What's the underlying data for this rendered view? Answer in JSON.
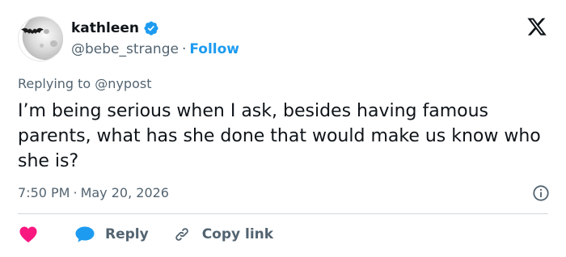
{
  "tweet": {
    "display_name": "kathleen",
    "handle": "@bebe_strange",
    "separator": "·",
    "follow_label": "Follow",
    "replying_prefix": "Replying to",
    "replying_to": "@nypost",
    "text": "I’m being serious when I ask, besides having famous parents, what has she done that would make us know who she is?",
    "time": "7:50 PM",
    "date": "May 20, 2026"
  },
  "actions": {
    "reply_label": "Reply",
    "copy_link_label": "Copy link"
  },
  "colors": {
    "accent": "#1d9bf0",
    "heart": "#f91880",
    "muted_text": "#536471",
    "primary_text": "#0f1419"
  },
  "icons": {
    "avatar": "moon-bat-avatar",
    "verified": "verified-badge-icon",
    "logo": "x-logo-icon",
    "info": "info-icon",
    "like": "heart-icon",
    "reply": "reply-bubble-icon",
    "copy": "link-icon"
  }
}
